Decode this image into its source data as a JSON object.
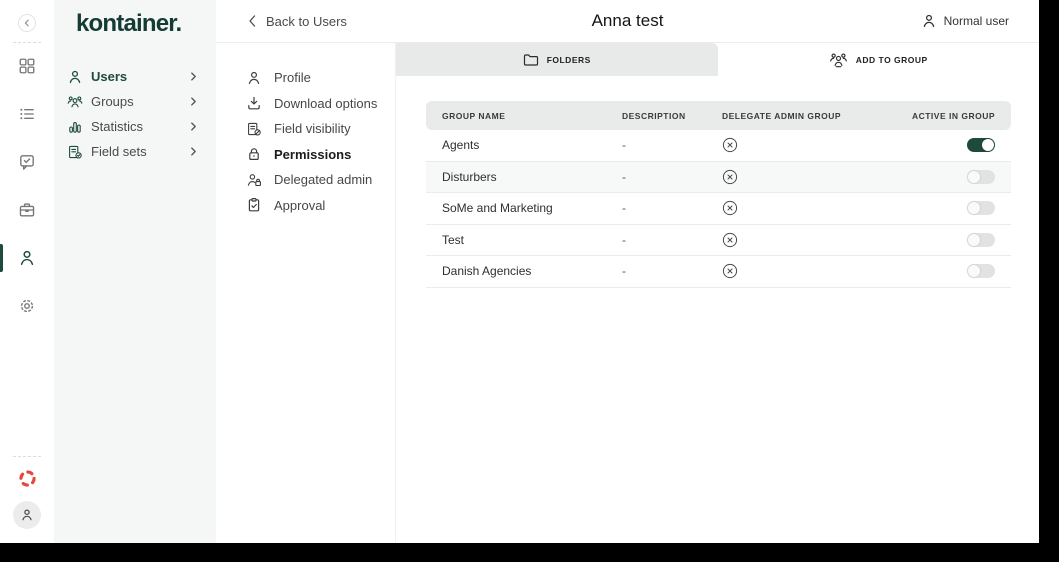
{
  "colors": {
    "brand_green": "#143c34",
    "active_green": "#1d4b3f",
    "toggle_on": "#1d4a3c",
    "accent_red": "#e8473d"
  },
  "sidebar": {
    "logo": "kontainer.",
    "items": [
      {
        "label": "Users",
        "active": true
      },
      {
        "label": "Groups",
        "active": false
      },
      {
        "label": "Statistics",
        "active": false
      },
      {
        "label": "Field sets",
        "active": false
      }
    ]
  },
  "panel": {
    "items": [
      {
        "label": "Profile",
        "active": false
      },
      {
        "label": "Download options",
        "active": false
      },
      {
        "label": "Field visibility",
        "active": false
      },
      {
        "label": "Permissions",
        "active": true
      },
      {
        "label": "Delegated admin",
        "active": false
      },
      {
        "label": "Approval",
        "active": false
      }
    ]
  },
  "header": {
    "back_label": "Back to Users",
    "title": "Anna test",
    "user_label": "Normal user"
  },
  "tabs": [
    {
      "label": "FOLDERS",
      "active": false
    },
    {
      "label": "ADD TO GROUP",
      "active": true
    }
  ],
  "table": {
    "columns": [
      "GROUP NAME",
      "DESCRIPTION",
      "DELEGATE ADMIN GROUP",
      "ACTIVE IN GROUP"
    ],
    "rows": [
      {
        "name": "Agents",
        "description": "-",
        "active_in_group": true
      },
      {
        "name": "Disturbers",
        "description": "-",
        "active_in_group": false
      },
      {
        "name": "SoMe and Marketing",
        "description": "-",
        "active_in_group": false
      },
      {
        "name": "Test",
        "description": "-",
        "active_in_group": false
      },
      {
        "name": "Danish Agencies",
        "description": "-",
        "active_in_group": false
      }
    ]
  }
}
